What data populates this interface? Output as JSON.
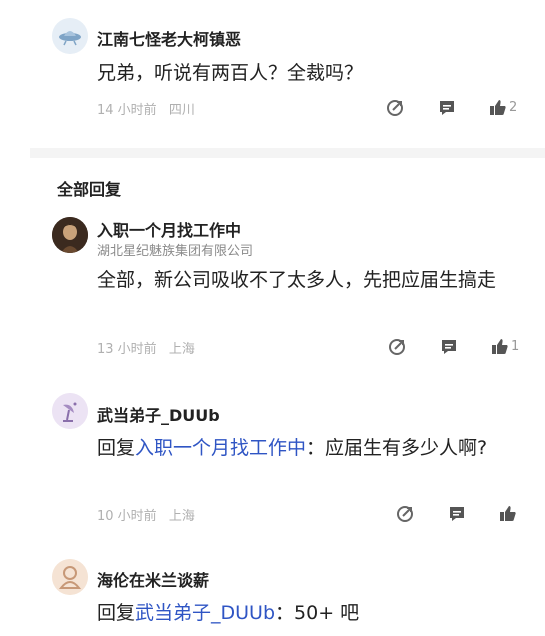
{
  "comments": [
    {
      "name": "江南七怪老大柯镇恶",
      "text": "兄弟，听说有两百人？全裁吗？",
      "time": "14 小时前",
      "location": "四川",
      "likes": "2"
    }
  ],
  "section_title": "全部回复",
  "replies": [
    {
      "name": "入职一个月找工作中",
      "company": "湖北星纪魅族集团有限公司",
      "text": "全部，新公司吸收不了太多人，先把应届生搞走",
      "time": "13 小时前",
      "location": "上海",
      "likes": "1"
    },
    {
      "name": "武当弟子_DUUb",
      "reply_prefix": "回复",
      "reply_target": "入职一个月找工作中",
      "text": "：应届生有多少人啊?",
      "time": "10 小时前",
      "location": "上海",
      "likes": ""
    },
    {
      "name": "海伦在米兰谈薪",
      "reply_prefix": "回复",
      "reply_target": "武当弟子_DUUb",
      "text": "：50+ 吧"
    }
  ],
  "icons": {
    "share": "share-edit-icon",
    "comment": "comment-bubble-icon",
    "like": "thumbs-up-icon"
  },
  "colors": {
    "link": "#2f55c4",
    "meta": "#b0b0b0",
    "divider": "#f4f4f4"
  }
}
